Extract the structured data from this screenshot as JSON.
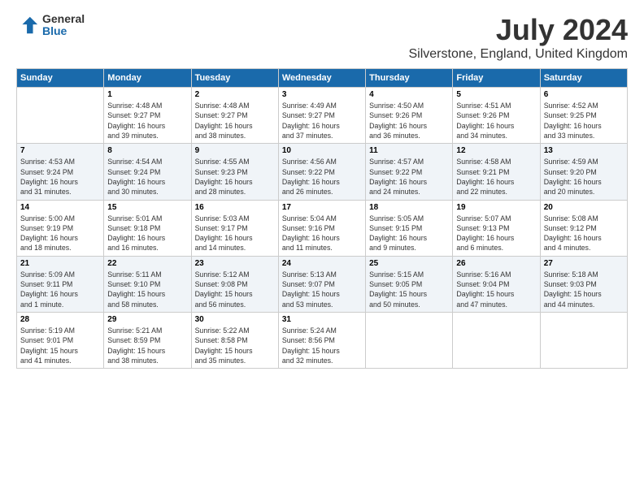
{
  "logo": {
    "general": "General",
    "blue": "Blue"
  },
  "header": {
    "title": "July 2024",
    "subtitle": "Silverstone, England, United Kingdom"
  },
  "days_of_week": [
    "Sunday",
    "Monday",
    "Tuesday",
    "Wednesday",
    "Thursday",
    "Friday",
    "Saturday"
  ],
  "weeks": [
    [
      {
        "day": "",
        "info": ""
      },
      {
        "day": "1",
        "info": "Sunrise: 4:48 AM\nSunset: 9:27 PM\nDaylight: 16 hours\nand 39 minutes."
      },
      {
        "day": "2",
        "info": "Sunrise: 4:48 AM\nSunset: 9:27 PM\nDaylight: 16 hours\nand 38 minutes."
      },
      {
        "day": "3",
        "info": "Sunrise: 4:49 AM\nSunset: 9:27 PM\nDaylight: 16 hours\nand 37 minutes."
      },
      {
        "day": "4",
        "info": "Sunrise: 4:50 AM\nSunset: 9:26 PM\nDaylight: 16 hours\nand 36 minutes."
      },
      {
        "day": "5",
        "info": "Sunrise: 4:51 AM\nSunset: 9:26 PM\nDaylight: 16 hours\nand 34 minutes."
      },
      {
        "day": "6",
        "info": "Sunrise: 4:52 AM\nSunset: 9:25 PM\nDaylight: 16 hours\nand 33 minutes."
      }
    ],
    [
      {
        "day": "7",
        "info": "Sunrise: 4:53 AM\nSunset: 9:24 PM\nDaylight: 16 hours\nand 31 minutes."
      },
      {
        "day": "8",
        "info": "Sunrise: 4:54 AM\nSunset: 9:24 PM\nDaylight: 16 hours\nand 30 minutes."
      },
      {
        "day": "9",
        "info": "Sunrise: 4:55 AM\nSunset: 9:23 PM\nDaylight: 16 hours\nand 28 minutes."
      },
      {
        "day": "10",
        "info": "Sunrise: 4:56 AM\nSunset: 9:22 PM\nDaylight: 16 hours\nand 26 minutes."
      },
      {
        "day": "11",
        "info": "Sunrise: 4:57 AM\nSunset: 9:22 PM\nDaylight: 16 hours\nand 24 minutes."
      },
      {
        "day": "12",
        "info": "Sunrise: 4:58 AM\nSunset: 9:21 PM\nDaylight: 16 hours\nand 22 minutes."
      },
      {
        "day": "13",
        "info": "Sunrise: 4:59 AM\nSunset: 9:20 PM\nDaylight: 16 hours\nand 20 minutes."
      }
    ],
    [
      {
        "day": "14",
        "info": "Sunrise: 5:00 AM\nSunset: 9:19 PM\nDaylight: 16 hours\nand 18 minutes."
      },
      {
        "day": "15",
        "info": "Sunrise: 5:01 AM\nSunset: 9:18 PM\nDaylight: 16 hours\nand 16 minutes."
      },
      {
        "day": "16",
        "info": "Sunrise: 5:03 AM\nSunset: 9:17 PM\nDaylight: 16 hours\nand 14 minutes."
      },
      {
        "day": "17",
        "info": "Sunrise: 5:04 AM\nSunset: 9:16 PM\nDaylight: 16 hours\nand 11 minutes."
      },
      {
        "day": "18",
        "info": "Sunrise: 5:05 AM\nSunset: 9:15 PM\nDaylight: 16 hours\nand 9 minutes."
      },
      {
        "day": "19",
        "info": "Sunrise: 5:07 AM\nSunset: 9:13 PM\nDaylight: 16 hours\nand 6 minutes."
      },
      {
        "day": "20",
        "info": "Sunrise: 5:08 AM\nSunset: 9:12 PM\nDaylight: 16 hours\nand 4 minutes."
      }
    ],
    [
      {
        "day": "21",
        "info": "Sunrise: 5:09 AM\nSunset: 9:11 PM\nDaylight: 16 hours\nand 1 minute."
      },
      {
        "day": "22",
        "info": "Sunrise: 5:11 AM\nSunset: 9:10 PM\nDaylight: 15 hours\nand 58 minutes."
      },
      {
        "day": "23",
        "info": "Sunrise: 5:12 AM\nSunset: 9:08 PM\nDaylight: 15 hours\nand 56 minutes."
      },
      {
        "day": "24",
        "info": "Sunrise: 5:13 AM\nSunset: 9:07 PM\nDaylight: 15 hours\nand 53 minutes."
      },
      {
        "day": "25",
        "info": "Sunrise: 5:15 AM\nSunset: 9:05 PM\nDaylight: 15 hours\nand 50 minutes."
      },
      {
        "day": "26",
        "info": "Sunrise: 5:16 AM\nSunset: 9:04 PM\nDaylight: 15 hours\nand 47 minutes."
      },
      {
        "day": "27",
        "info": "Sunrise: 5:18 AM\nSunset: 9:03 PM\nDaylight: 15 hours\nand 44 minutes."
      }
    ],
    [
      {
        "day": "28",
        "info": "Sunrise: 5:19 AM\nSunset: 9:01 PM\nDaylight: 15 hours\nand 41 minutes."
      },
      {
        "day": "29",
        "info": "Sunrise: 5:21 AM\nSunset: 8:59 PM\nDaylight: 15 hours\nand 38 minutes."
      },
      {
        "day": "30",
        "info": "Sunrise: 5:22 AM\nSunset: 8:58 PM\nDaylight: 15 hours\nand 35 minutes."
      },
      {
        "day": "31",
        "info": "Sunrise: 5:24 AM\nSunset: 8:56 PM\nDaylight: 15 hours\nand 32 minutes."
      },
      {
        "day": "",
        "info": ""
      },
      {
        "day": "",
        "info": ""
      },
      {
        "day": "",
        "info": ""
      }
    ]
  ],
  "accent_color": "#1a6aab"
}
